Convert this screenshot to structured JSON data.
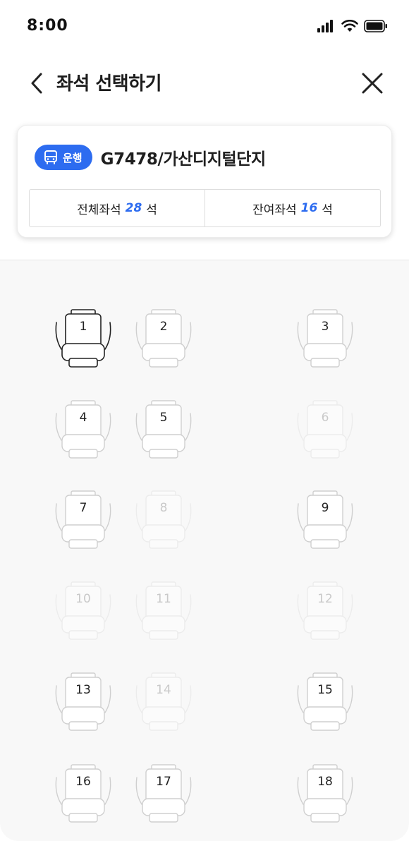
{
  "status_bar": {
    "time": "8:00"
  },
  "header": {
    "title": "좌석 선택하기"
  },
  "route": {
    "badge_label": "운행",
    "name": "G7478/가산디지털단지",
    "total_label": "전체좌석",
    "total_count": "28",
    "remaining_label": "잔여좌석",
    "remaining_count": "16",
    "unit": "석"
  },
  "seats": [
    {
      "label": "1",
      "state": "selected"
    },
    {
      "label": "2",
      "state": "available"
    },
    {
      "label": "3",
      "state": "available"
    },
    {
      "label": "4",
      "state": "available"
    },
    {
      "label": "5",
      "state": "available"
    },
    {
      "label": "6",
      "state": "taken"
    },
    {
      "label": "7",
      "state": "available"
    },
    {
      "label": "8",
      "state": "taken"
    },
    {
      "label": "9",
      "state": "available"
    },
    {
      "label": "10",
      "state": "taken"
    },
    {
      "label": "11",
      "state": "taken"
    },
    {
      "label": "12",
      "state": "taken"
    },
    {
      "label": "13",
      "state": "available"
    },
    {
      "label": "14",
      "state": "taken"
    },
    {
      "label": "15",
      "state": "available"
    },
    {
      "label": "16",
      "state": "available"
    },
    {
      "label": "17",
      "state": "available"
    },
    {
      "label": "18",
      "state": "available"
    }
  ],
  "colors": {
    "accent": "#2d6cf0",
    "selected_stroke": "#222222",
    "available_stroke": "#cfcfcf",
    "taken_stroke": "#dedede"
  }
}
